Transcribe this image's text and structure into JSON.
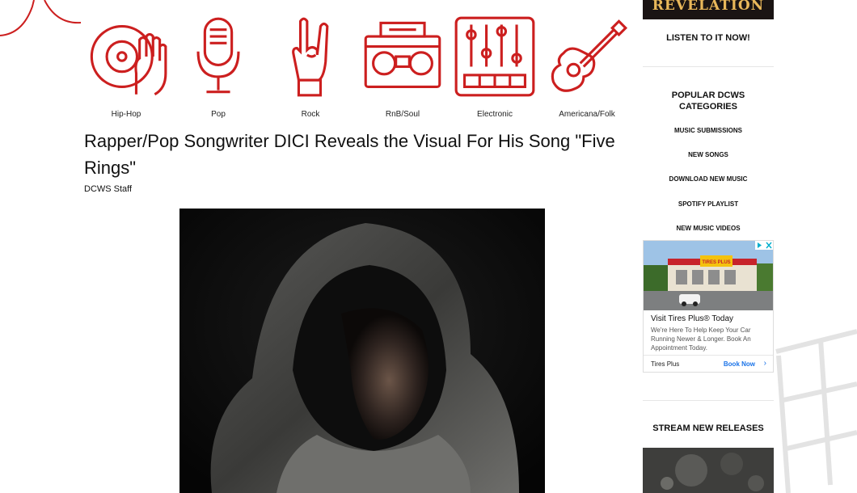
{
  "genres": [
    {
      "label": "Hip-Hop",
      "icon": "turntable-hand-icon"
    },
    {
      "label": "Pop",
      "icon": "microphone-icon"
    },
    {
      "label": "Rock",
      "icon": "rock-hand-icon"
    },
    {
      "label": "RnB/Soul",
      "icon": "boombox-icon"
    },
    {
      "label": "Electronic",
      "icon": "mixer-icon"
    },
    {
      "label": "Americana/Folk",
      "icon": "guitar-icon"
    }
  ],
  "article": {
    "title": "Rapper/Pop Songwriter DICI Reveals the Visual For His Song \"Five Rings\"",
    "byline": "DCWS Staff"
  },
  "sidebar": {
    "banner_text": "REVELATION",
    "listen_label": "LISTEN TO IT NOW!",
    "categories_title": "POPULAR DCWS CATEGORIES",
    "links": [
      "MUSIC SUBMISSIONS",
      "NEW SONGS",
      "DOWNLOAD NEW MUSIC",
      "SPOTIFY PLAYLIST",
      "NEW MUSIC VIDEOS"
    ],
    "ad": {
      "headline": "Visit Tires Plus® Today",
      "body": "We're Here To Help Keep Your Car Running Newer & Longer. Book An Appointment Today.",
      "brand": "Tires Plus",
      "cta": "Book Now",
      "sign_text": "TIRES PLUS"
    },
    "stream_title": "STREAM NEW RELEASES"
  },
  "colors": {
    "accent_red": "#cc1f1f",
    "text": "#111111",
    "ad_link": "#1a73e8"
  }
}
